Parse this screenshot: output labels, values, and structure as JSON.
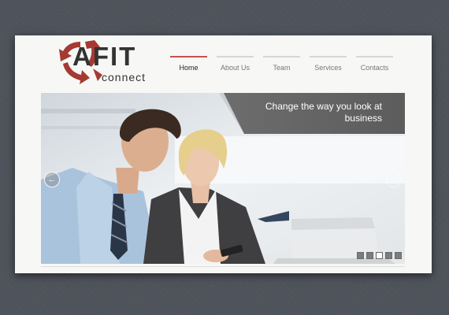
{
  "logo": {
    "main": "AFIT",
    "sub": "connect",
    "accent_color": "#a53a33"
  },
  "nav": {
    "items": [
      {
        "label": "Home",
        "active": true
      },
      {
        "label": "About Us",
        "active": false
      },
      {
        "label": "Team",
        "active": false
      },
      {
        "label": "Services",
        "active": false
      },
      {
        "label": "Contacts",
        "active": false
      }
    ],
    "active_color": "#c0524f"
  },
  "slider": {
    "tagline": "Change the way you look at business",
    "prev_icon": "arrow-left-icon",
    "next_icon": "arrow-right-icon",
    "slide_count": 5,
    "active_slide": 3
  }
}
